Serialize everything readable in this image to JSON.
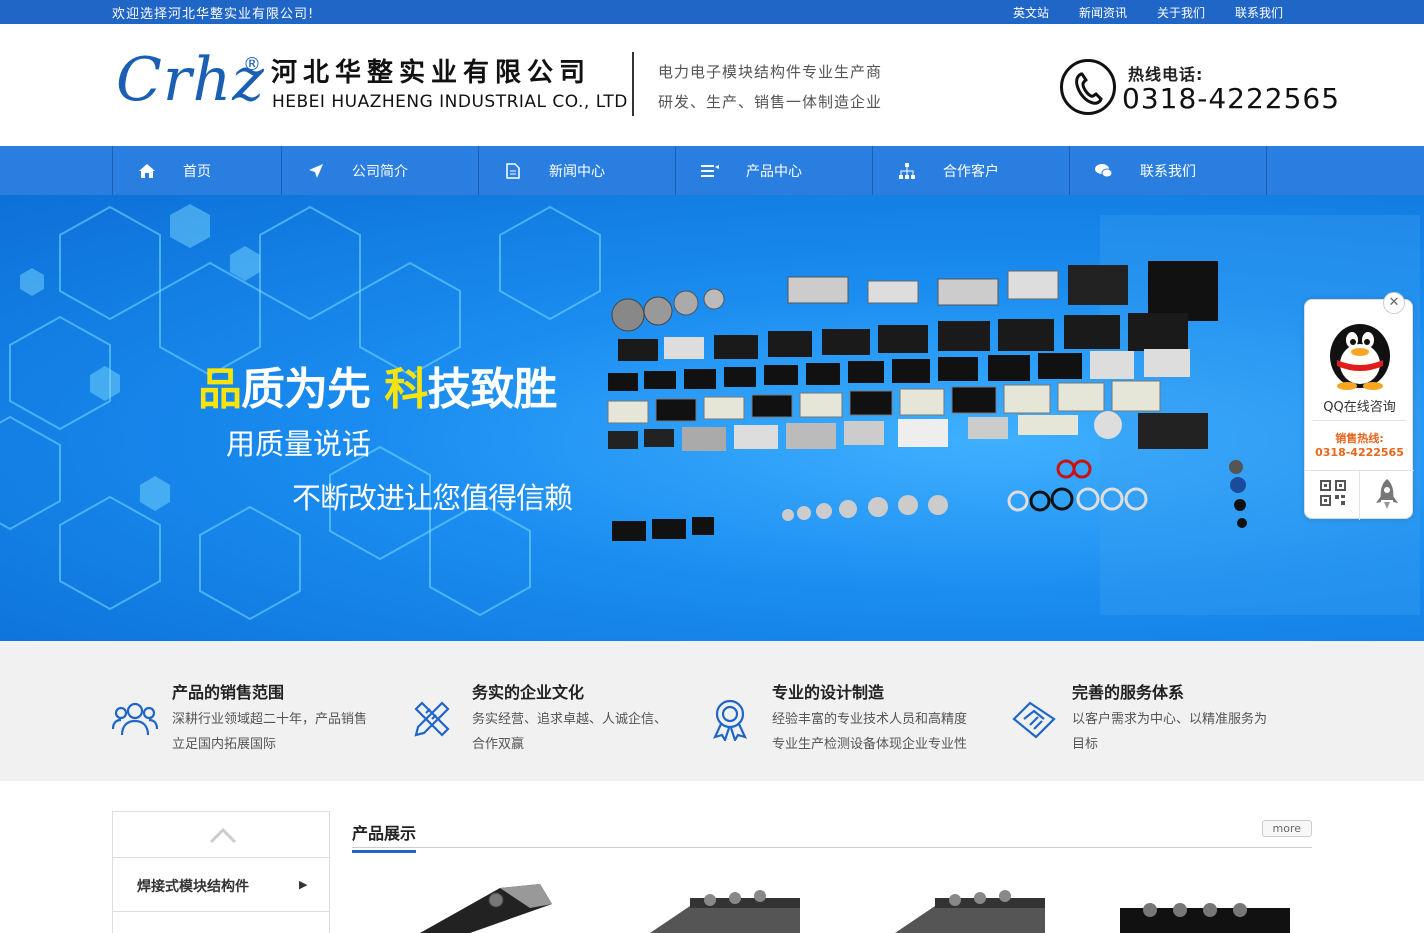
{
  "topbar": {
    "welcome": "欢迎选择河北华整实业有限公司!",
    "links": [
      "英文站",
      "新闻资讯",
      "关于我们",
      "联系我们"
    ]
  },
  "header": {
    "logo_mark": "Crhz",
    "logo_reg": "®",
    "company_cn": "河北华整实业有限公司",
    "company_en": "HEBEI HUAZHENG INDUSTRIAL CO., LTD",
    "slogan1": "电力电子模块结构件专业生产商",
    "slogan2": "研发、生产、销售一体制造企业",
    "hotline_label": "热线电话:",
    "hotline_number": "0318-4222565"
  },
  "nav": {
    "items": [
      {
        "label": "首页",
        "icon": "home-icon"
      },
      {
        "label": "公司简介",
        "icon": "send-icon"
      },
      {
        "label": "新闻中心",
        "icon": "document-icon"
      },
      {
        "label": "产品中心",
        "icon": "list-icon"
      },
      {
        "label": "合作客户",
        "icon": "sitemap-icon"
      },
      {
        "label": "联系我们",
        "icon": "chat-icon"
      }
    ]
  },
  "banner": {
    "headline_hl1": "品",
    "headline_part1": "质为先 ",
    "headline_hl2": "科",
    "headline_part2": "技致胜",
    "line2": "用质量说话",
    "line3": "不断改进让您值得信赖"
  },
  "qq_float": {
    "close": "✕",
    "label": "QQ在线咨询",
    "sales_label": "销售热线:",
    "sales_number": "0318-4222565"
  },
  "features": [
    {
      "title": "产品的销售范围",
      "desc": "深耕行业领域超二十年，产品销售立足国内拓展国际",
      "icon": "users-icon"
    },
    {
      "title": "务实的企业文化",
      "desc": "务实经营、追求卓越、人诚企信、合作双赢",
      "icon": "tools-icon"
    },
    {
      "title": "专业的设计制造",
      "desc": "经验丰富的专业技术人员和高精度专业生产检测设备体现企业专业性",
      "icon": "award-icon"
    },
    {
      "title": "完善的服务体系",
      "desc": "以客户需求为中心、以精准服务为目标",
      "icon": "handshake-icon"
    }
  ],
  "sidebar": {
    "item": "焊接式模块结构件"
  },
  "products": {
    "title": "产品展示",
    "more": "more"
  },
  "colors": {
    "brand_blue": "#1f66c7",
    "nav_blue": "#2a7ee0",
    "highlight_yellow": "#f8e30c",
    "sales_orange": "#e8661b"
  }
}
